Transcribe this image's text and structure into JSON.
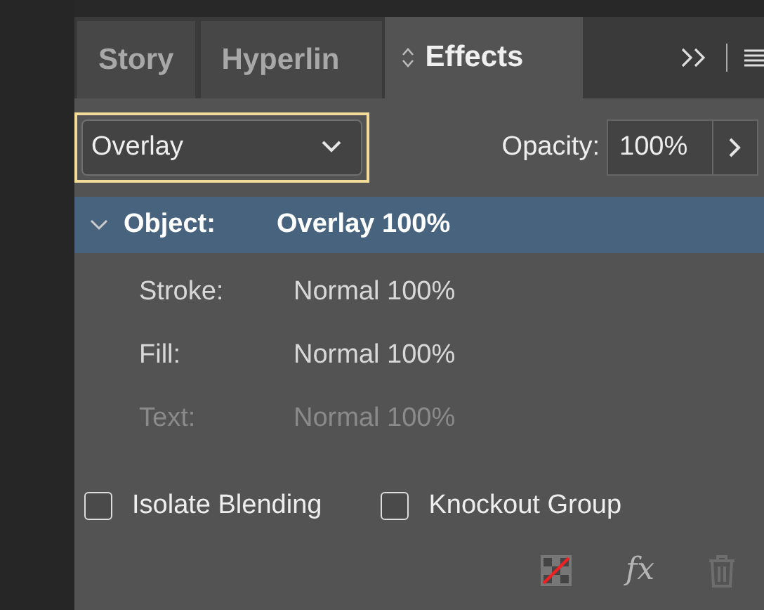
{
  "tabs": [
    {
      "label": "Story",
      "selected": false
    },
    {
      "label": "Hyperlin",
      "selected": false
    },
    {
      "label": "Effects",
      "selected": true
    }
  ],
  "blend_mode": {
    "value": "Overlay",
    "focused": true
  },
  "opacity": {
    "label": "Opacity:",
    "value": "100%"
  },
  "layers": [
    {
      "label": "Object:",
      "value": "Overlay 100%",
      "selected": true,
      "expanded": true,
      "disabled": false
    },
    {
      "label": "Stroke:",
      "value": "Normal 100%",
      "selected": false,
      "disabled": false
    },
    {
      "label": "Fill:",
      "value": "Normal 100%",
      "selected": false,
      "disabled": false
    },
    {
      "label": "Text:",
      "value": "Normal 100%",
      "selected": false,
      "disabled": true
    }
  ],
  "options": [
    {
      "label": "Isolate Blending",
      "checked": false
    },
    {
      "label": "Knockout Group",
      "checked": false
    }
  ],
  "fx_button": {
    "label": "fx"
  }
}
